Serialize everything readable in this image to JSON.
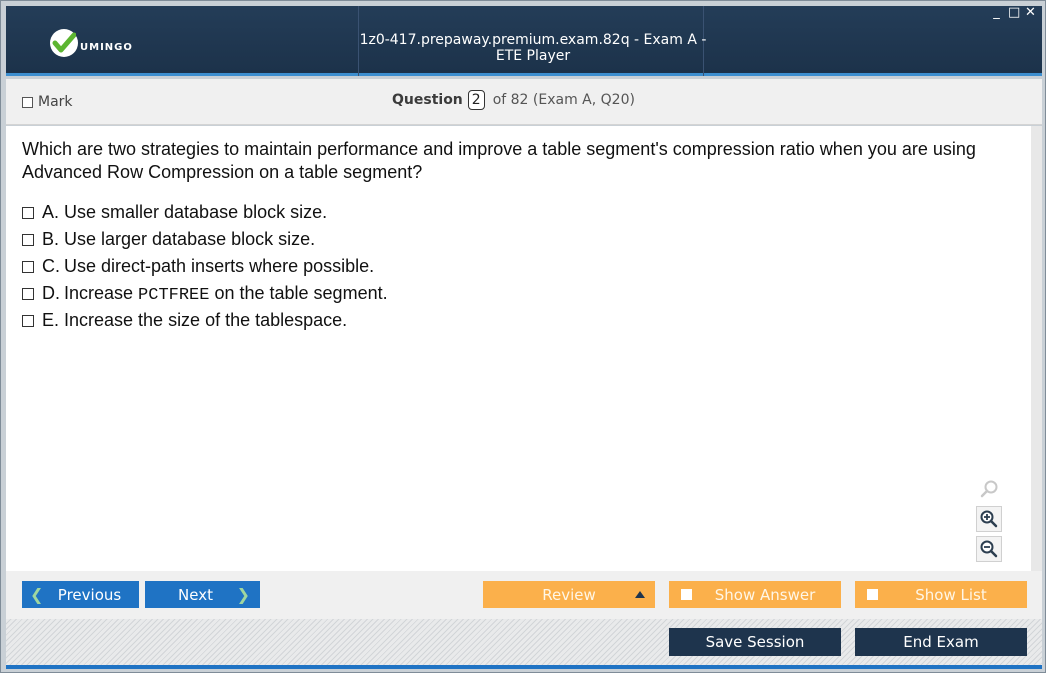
{
  "app": {
    "logo_text": "UMINGO",
    "window_title": "1z0-417.prepaway.premium.exam.82q - Exam A - ETE Player",
    "window_controls": {
      "minimize": "_",
      "maximize": "□",
      "close": "✕"
    }
  },
  "header": {
    "mark_label": "Mark",
    "question_label": "Question",
    "question_number": "2",
    "question_of": "of 82 (Exam A, Q20)"
  },
  "question": {
    "text": "Which are two strategies to maintain performance and improve a table segment's compression ratio when you are using Advanced Row Compression on a table segment?",
    "options": [
      {
        "letter": "A.",
        "text": "Use smaller database block size."
      },
      {
        "letter": "B.",
        "text": "Use larger database block size."
      },
      {
        "letter": "C.",
        "text": "Use direct-path inserts where possible."
      },
      {
        "letter": "D.",
        "text_before": "Increase ",
        "code": "PCTFREE",
        "text_after": " on the table segment."
      },
      {
        "letter": "E.",
        "text": "Increase the size of the tablespace."
      }
    ]
  },
  "navigation": {
    "previous_label": "Previous",
    "next_label": "Next",
    "review_label": "Review",
    "show_answer_label": "Show Answer",
    "show_list_label": "Show List",
    "save_session_label": "Save Session",
    "end_exam_label": "End Exam"
  },
  "icons": {
    "logo": "check-circle-icon",
    "search": "magnifier-icon",
    "zoom_in": "zoom-in-icon",
    "zoom_out": "zoom-out-icon",
    "prev": "chevron-left-icon",
    "next": "chevron-right-icon",
    "review_menu": "triangle-up-icon"
  },
  "colors": {
    "titlebar": "#1f3650",
    "accent_blue": "#1f73c4",
    "orange": "#fbb04b",
    "dark_button": "#1e344d",
    "logo_green": "#5cb531"
  }
}
